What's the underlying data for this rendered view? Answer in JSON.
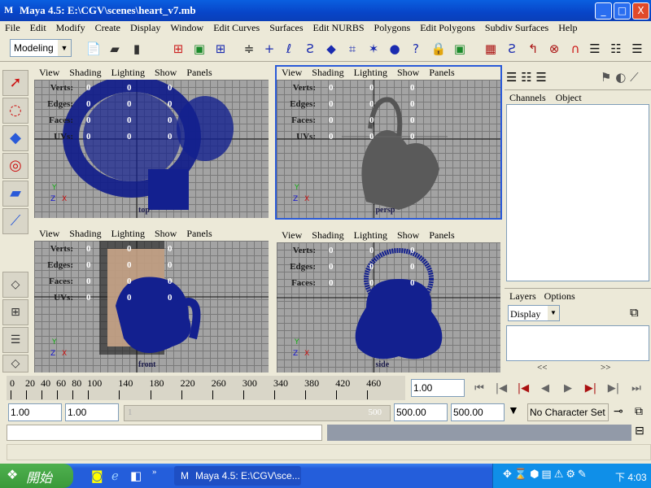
{
  "window": {
    "title": "Maya 4.5: E:\\CGV\\scenes\\heart_v7.mb",
    "minimize": "_",
    "maximize": "□",
    "close": "X"
  },
  "menu": [
    "File",
    "Edit",
    "Modify",
    "Create",
    "Display",
    "Window",
    "Edit Curves",
    "Surfaces",
    "Edit NURBS",
    "Polygons",
    "Edit Polygons",
    "Subdiv Surfaces",
    "Help"
  ],
  "toolbar": {
    "mode": "Modeling"
  },
  "viewports": [
    {
      "menu": [
        "View",
        "Shading",
        "Lighting",
        "Show",
        "Panels"
      ],
      "hud": [
        "Verts:",
        "Edges:",
        "Faces:",
        "UVs:"
      ],
      "values": [
        "0",
        "0",
        "0"
      ],
      "camera": "top",
      "active": false
    },
    {
      "menu": [
        "View",
        "Shading",
        "Lighting",
        "Show",
        "Panels"
      ],
      "hud": [
        "Verts:",
        "Edges:",
        "Faces:",
        "UVs:"
      ],
      "values": [
        "0",
        "0",
        "0"
      ],
      "camera": "persp",
      "active": true
    },
    {
      "menu": [
        "View",
        "Shading",
        "Lighting",
        "Show",
        "Panels"
      ],
      "hud": [
        "Verts:",
        "Edges:",
        "Faces:",
        "UVs:"
      ],
      "values": [
        "0",
        "0",
        "0"
      ],
      "camera": "front",
      "active": false
    },
    {
      "menu": [
        "View",
        "Shading",
        "Lighting",
        "Show",
        "Panels"
      ],
      "hud": [
        "Verts:",
        "Edges:",
        "Faces:"
      ],
      "values": [
        "0",
        "0",
        "0"
      ],
      "camera": "side",
      "active": false
    }
  ],
  "channel_box": {
    "tabs": [
      "Channels",
      "Object"
    ]
  },
  "layers": {
    "tabs": [
      "Layers",
      "Options"
    ],
    "dropdown": "Display",
    "scroll_left": "<<",
    "scroll_right": ">>"
  },
  "timeline": {
    "ticks": [
      "0",
      "20",
      "40",
      "60",
      "80",
      "100",
      "140",
      "180",
      "220",
      "260",
      "300",
      "340",
      "380",
      "420",
      "460"
    ],
    "current_time": "1.00"
  },
  "range": {
    "start": "1.00",
    "playback_start": "1.00",
    "slider_min": "1",
    "slider_max": "500",
    "playback_end": "500.00",
    "end": "500.00",
    "character_set": "No Character Set"
  },
  "taskbar": {
    "start": "開始",
    "task": "Maya 4.5: E:\\CGV\\sce...",
    "clock": "下 4:03"
  }
}
